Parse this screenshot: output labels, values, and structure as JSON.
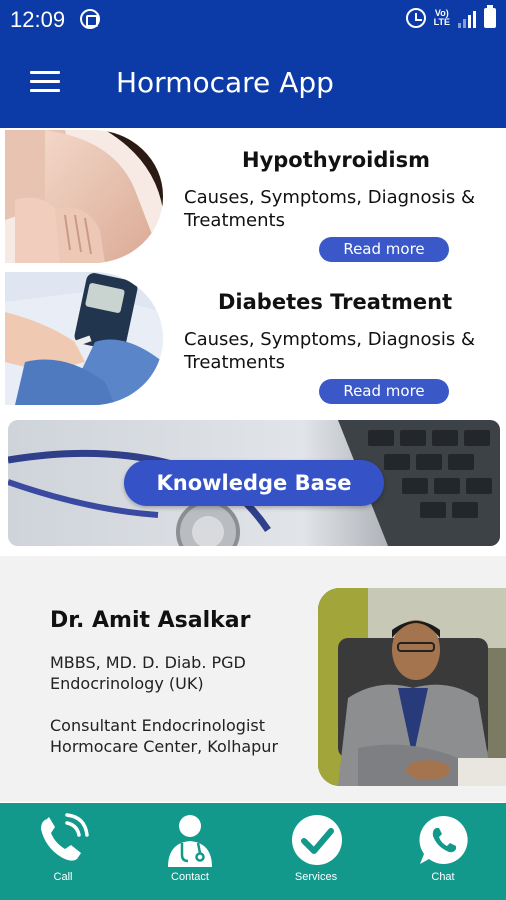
{
  "status_bar": {
    "time": "12:09",
    "volte_line1": "Vo)",
    "volte_line2": "LTE"
  },
  "app_bar": {
    "title": "Hormocare App",
    "menu_icon": "hamburger-menu-icon"
  },
  "articles": [
    {
      "title": "Hypothyroidism",
      "line1": "Causes, Symptoms, Diagnosis &",
      "line2": "Treatments",
      "button": "Read more"
    },
    {
      "title": "Diabetes Treatment",
      "line1": "Causes, Symptoms, Diagnosis &",
      "line2": "Treatments",
      "button": "Read more"
    }
  ],
  "knowledge_base": {
    "button": "Knowledge Base"
  },
  "doctor": {
    "name": "Dr. Amit Asalkar",
    "qual_line1": "MBBS, MD. D. Diab. PGD",
    "qual_line2": "Endocrinology (UK)",
    "role_line1": "Consultant Endocrinologist",
    "role_line2": "Hormocare Center, Kolhapur"
  },
  "bottom_nav": [
    {
      "label": "Call",
      "icon": "phone-icon"
    },
    {
      "label": "Contact",
      "icon": "doctor-icon"
    },
    {
      "label": "Services",
      "icon": "checkmark-icon"
    },
    {
      "label": "Chat",
      "icon": "whatsapp-icon"
    }
  ],
  "colors": {
    "primary": "#0c3aa6",
    "accent_button": "#3b58c9",
    "bottom_nav": "#13998c",
    "doctor_bg": "#f2f2f2"
  }
}
